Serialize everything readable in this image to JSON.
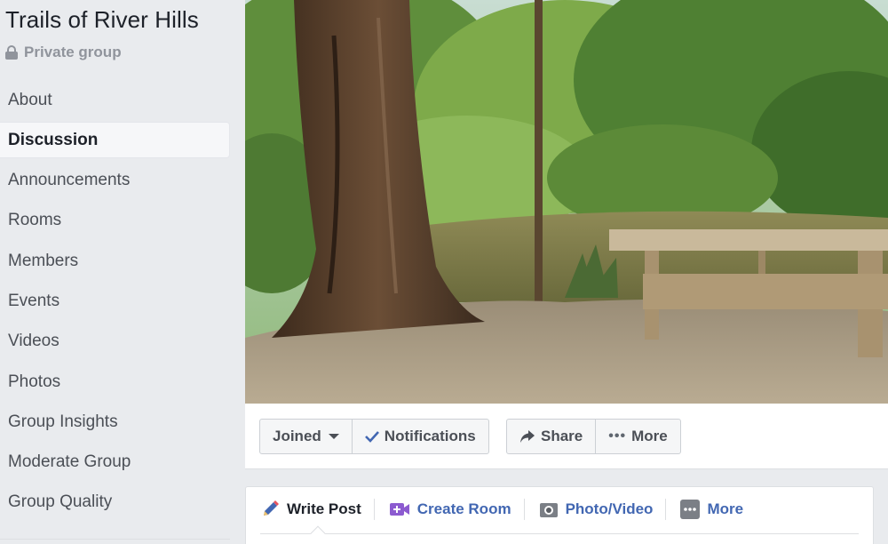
{
  "group": {
    "title": "Trails of River Hills",
    "privacy": "Private group"
  },
  "sidebar": {
    "items": [
      {
        "label": "About"
      },
      {
        "label": "Discussion",
        "active": true
      },
      {
        "label": "Announcements"
      },
      {
        "label": "Rooms"
      },
      {
        "label": "Members"
      },
      {
        "label": "Events"
      },
      {
        "label": "Videos"
      },
      {
        "label": "Photos"
      },
      {
        "label": "Group Insights"
      },
      {
        "label": "Moderate Group"
      },
      {
        "label": "Group Quality"
      }
    ]
  },
  "actions": {
    "joined": "Joined",
    "notifications": "Notifications",
    "share": "Share",
    "more": "More"
  },
  "composer": {
    "write_post": "Write Post",
    "create_room": "Create Room",
    "photo_video": "Photo/Video",
    "more": "More"
  },
  "icons": {
    "privacy": "lock-icon",
    "joined_dropdown": "caret-down-icon",
    "notifications": "checkmark-icon",
    "share": "share-arrow-icon",
    "more": "ellipsis-icon",
    "write_post": "pencil-icon",
    "create_room": "video-plus-icon",
    "photo_video": "camera-icon",
    "composer_more": "ellipsis-icon"
  },
  "colors": {
    "link": "#4267b2",
    "background": "#e9ebee"
  }
}
